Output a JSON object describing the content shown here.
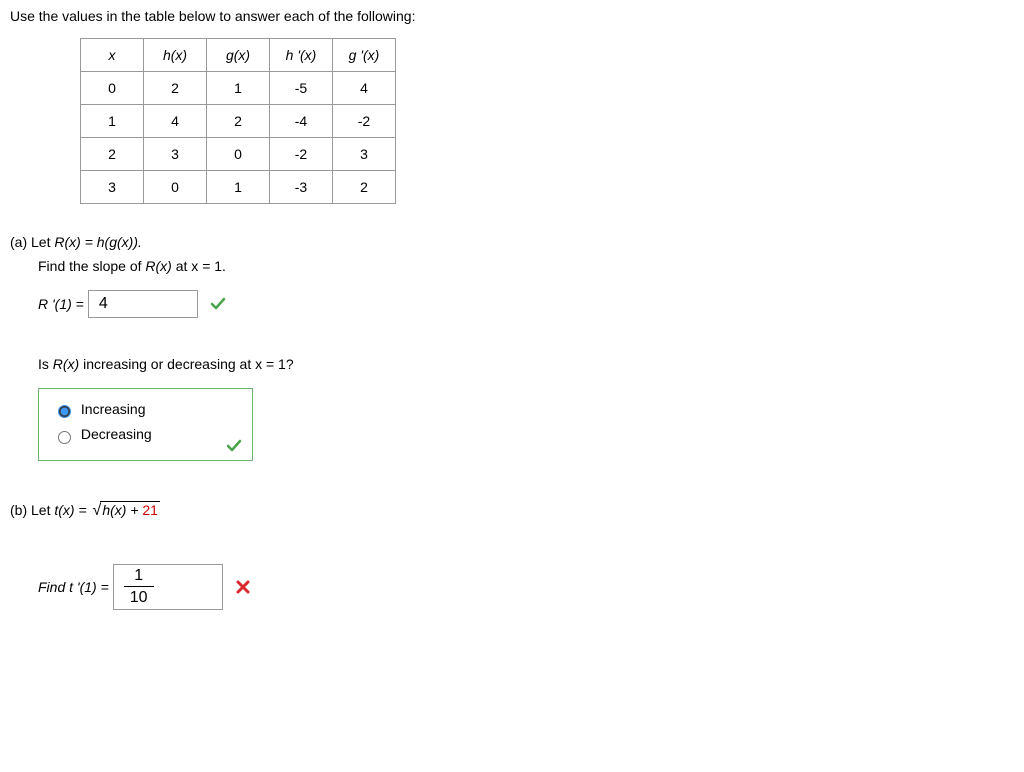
{
  "prompt": "Use the values in the table below to answer each of the following:",
  "table": {
    "headers": [
      "x",
      "h(x)",
      "g(x)",
      "h '(x)",
      "g '(x)"
    ],
    "rows": [
      [
        "0",
        "2",
        "1",
        "-5",
        "4"
      ],
      [
        "1",
        "4",
        "2",
        "-4",
        "-2"
      ],
      [
        "2",
        "3",
        "0",
        "-2",
        "3"
      ],
      [
        "3",
        "0",
        "1",
        "-3",
        "2"
      ]
    ]
  },
  "partA": {
    "label": "(a) Let ",
    "def_lhs": "R",
    "def_expr": "(x) = h(g(x)).",
    "q1_pre": "Find the slope of ",
    "q1_mid": "R(x)",
    "q1_post": " at x = 1.",
    "ans_label": "R '(1) = ",
    "ans_value": "4",
    "q2_pre": "Is ",
    "q2_mid": "R(x)",
    "q2_post": " increasing or decreasing at x = 1?",
    "opt_inc": "Increasing",
    "opt_dec": "Decreasing",
    "selected": "inc"
  },
  "partB": {
    "label": "(b) Let  ",
    "t_lhs": "t(x) = ",
    "rad_expr": "h(x) + ",
    "rad_const": "21",
    "find_label": "Find t '(1) = ",
    "ans_numer": "1",
    "ans_denom": "10"
  }
}
